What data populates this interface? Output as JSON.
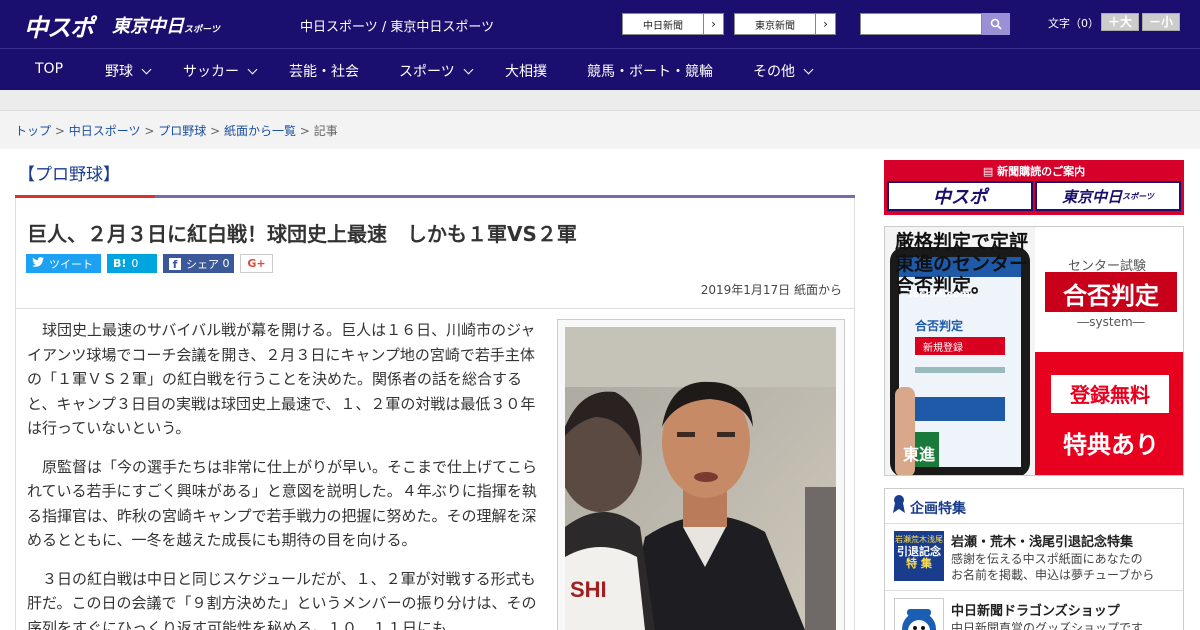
{
  "header": {
    "logo_main": "中スポ",
    "logo_tokyo": "東京中日",
    "logo_tokyo_small": "スポーツ",
    "site_name": "中日スポーツ / 東京中日スポーツ",
    "links": [
      "中日新聞",
      "東京新聞"
    ],
    "search_placeholder": "",
    "font_size_label": "文字（0）",
    "font_plus": "＋大",
    "font_minus": "－小"
  },
  "nav": {
    "items": [
      {
        "label": "TOP",
        "dropdown": false
      },
      {
        "label": "野球",
        "dropdown": true
      },
      {
        "label": "サッカー",
        "dropdown": true
      },
      {
        "label": "芸能・社会",
        "dropdown": false
      },
      {
        "label": "スポーツ",
        "dropdown": true
      },
      {
        "label": "大相撲",
        "dropdown": false
      },
      {
        "label": "競馬・ボート・競輪",
        "dropdown": false
      },
      {
        "label": "その他",
        "dropdown": true
      }
    ]
  },
  "breadcrumb": {
    "items": [
      "トップ",
      "中日スポーツ",
      "プロ野球",
      "紙面から一覧"
    ],
    "separator": ">",
    "current": "記事"
  },
  "article": {
    "category": "【プロ野球】",
    "headline": "巨人、２月３日に紅白戦！球団史上最速　しかも１軍VS２軍",
    "share": {
      "tweet": "ツイート",
      "hatena_icon": "B!",
      "hatena_count": "0",
      "facebook_label": "シェア",
      "facebook_count": "0",
      "gplus": "G+"
    },
    "dateline": "2019年1月17日 紙面から",
    "paragraphs": [
      "球団史上最速のサバイバル戦が幕を開ける。巨人は１６日、川崎市のジャイアンツ球場でコーチ会議を開き、２月３日にキャンプ地の宮崎で若手主体の「１軍ＶＳ２軍」の紅白戦を行うことを決めた。関係者の話を総合すると、キャンプ３日目の実戦は球団史上最速で、１、２軍の対戦は最低３０年は行っていないという。",
      "原監督は「今の選手たちは非常に仕上がりが早い。そこまで仕上げてこられている若手にすごく興味がある」と意図を説明した。４年ぶりに指揮を執る指揮官は、昨秋の宮崎キャンプで若手戦力の把握に努めた。その理解を深めるとともに、一冬を越えた成長にも期待の目を向ける。",
      "３日の紅白戦は中日と同じスケジュールだが、１、２軍が対戦する形式も肝だ。この日の会議で「９割方決めた」というメンバーの振り分けは、その序列をすぐにひっくり返す可能性を秘める。１０、１１日にも"
    ]
  },
  "sidebar": {
    "subscribe_title": "新聞購読のご案内",
    "subscribe_chuspo": "中スポ",
    "subscribe_tokyo": "東京中日",
    "subscribe_tokyo_small": "スポーツ",
    "ad": {
      "headline_line1": "厳格判定で定評",
      "headline_line2": "東進のセンター",
      "headline_line3": "合否判定。",
      "exam_label": "センター試験",
      "product": "合否判定",
      "product_sub": "―system―",
      "phone_site": "Toshin.com",
      "phone_title": "合否判定",
      "phone_register": "新規登録",
      "brand": "東進",
      "cta1": "登録無料",
      "cta2": "特典あり"
    },
    "features_title": "企画特集",
    "features": [
      {
        "icon_text": [
          "岩瀬荒木浅尾",
          "引退記念",
          "特 集"
        ],
        "title": "岩瀬・荒木・浅尾引退記念特集",
        "desc": [
          "感謝を伝える中スポ紙面にあなたの",
          "お名前を掲載、申込は夢チューブから"
        ]
      },
      {
        "title": "中日新聞ドラゴンズショップ",
        "desc": [
          "中日新聞直営のグッズショップです"
        ]
      }
    ]
  },
  "colors": {
    "header_bg": "#1a0f6e",
    "accent_red": "#d8322a",
    "link_blue": "#1a4fa0",
    "twitter": "#1da1f2",
    "hatena": "#00a4de",
    "facebook": "#3b5998"
  }
}
